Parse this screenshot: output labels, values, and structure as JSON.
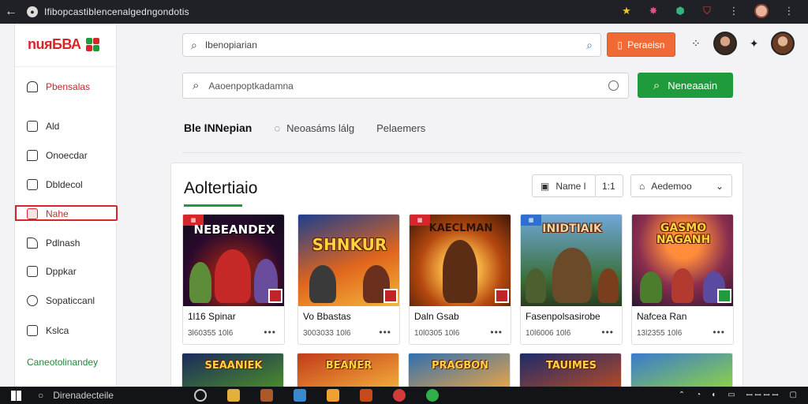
{
  "browser": {
    "back": "←",
    "url": "Ifibopcastiblencenalgedngondotis"
  },
  "sidebar": {
    "logo": "nuяБВА",
    "items": [
      {
        "label": "Pbensalas",
        "icon": "home-icon"
      },
      {
        "label": "Ald",
        "icon": "grid-icon"
      },
      {
        "label": "Onoecdar",
        "icon": "chat-icon"
      },
      {
        "label": "Dbldecol",
        "icon": "file-icon"
      },
      {
        "label": "Nahe",
        "icon": "box-icon"
      },
      {
        "label": "Pdlnash",
        "icon": "bookmark-icon"
      },
      {
        "label": "Dppkar",
        "icon": "folder-icon"
      },
      {
        "label": "Sopaticcanl",
        "icon": "settings-icon"
      },
      {
        "label": "Kslca",
        "icon": "user-icon"
      }
    ],
    "footer_link": "Caneotolinandey"
  },
  "header": {
    "search_placeholder": "Ibenopiarian",
    "orange_button": "Peraeisn"
  },
  "search": {
    "placeholder": "Aaoenpoptkadamna",
    "button": "Neneaaain"
  },
  "tabs": [
    {
      "label": "Ble INNepian"
    },
    {
      "label": "Neoasáms lálg"
    },
    {
      "label": "Pelaemers"
    }
  ],
  "panel": {
    "title": "Aoltertiaio",
    "name_filter": "Name l",
    "count": "1:1",
    "category_filter": "Aedemoo"
  },
  "cards": [
    {
      "art_title": "NEBEANDEX",
      "name": "1l16  Spinar",
      "meta": "3l60355  10l6"
    },
    {
      "art_title": "SHNKUR",
      "name": "Vo  Bbastas",
      "meta": "3003033  10l6"
    },
    {
      "art_title": "KAECLMAN",
      "name": "Daln  Gsab",
      "meta": "10l0305  10l6"
    },
    {
      "art_title": "INIDTIAIK",
      "name": "Fasenpolsasirobe",
      "meta": "10l6006  10l6"
    },
    {
      "art_title": "GASMO NAGANH",
      "name": "Nafcea  Ran",
      "meta": "13l2355  10l6"
    }
  ],
  "row2": [
    {
      "art_title": "SEAANIEK"
    },
    {
      "art_title": "BEANER"
    },
    {
      "art_title": "PRAGBON"
    },
    {
      "art_title": "TAUIMES"
    },
    {
      "art_title": ""
    }
  ],
  "taskbar": {
    "search": "Direnadecteile",
    "tray": "ꟷ ꟷ ꟷ ꟷ"
  },
  "colors": {
    "brand_red": "#d7262b",
    "accent_green": "#1f9b3d",
    "accent_orange": "#f06a35"
  }
}
